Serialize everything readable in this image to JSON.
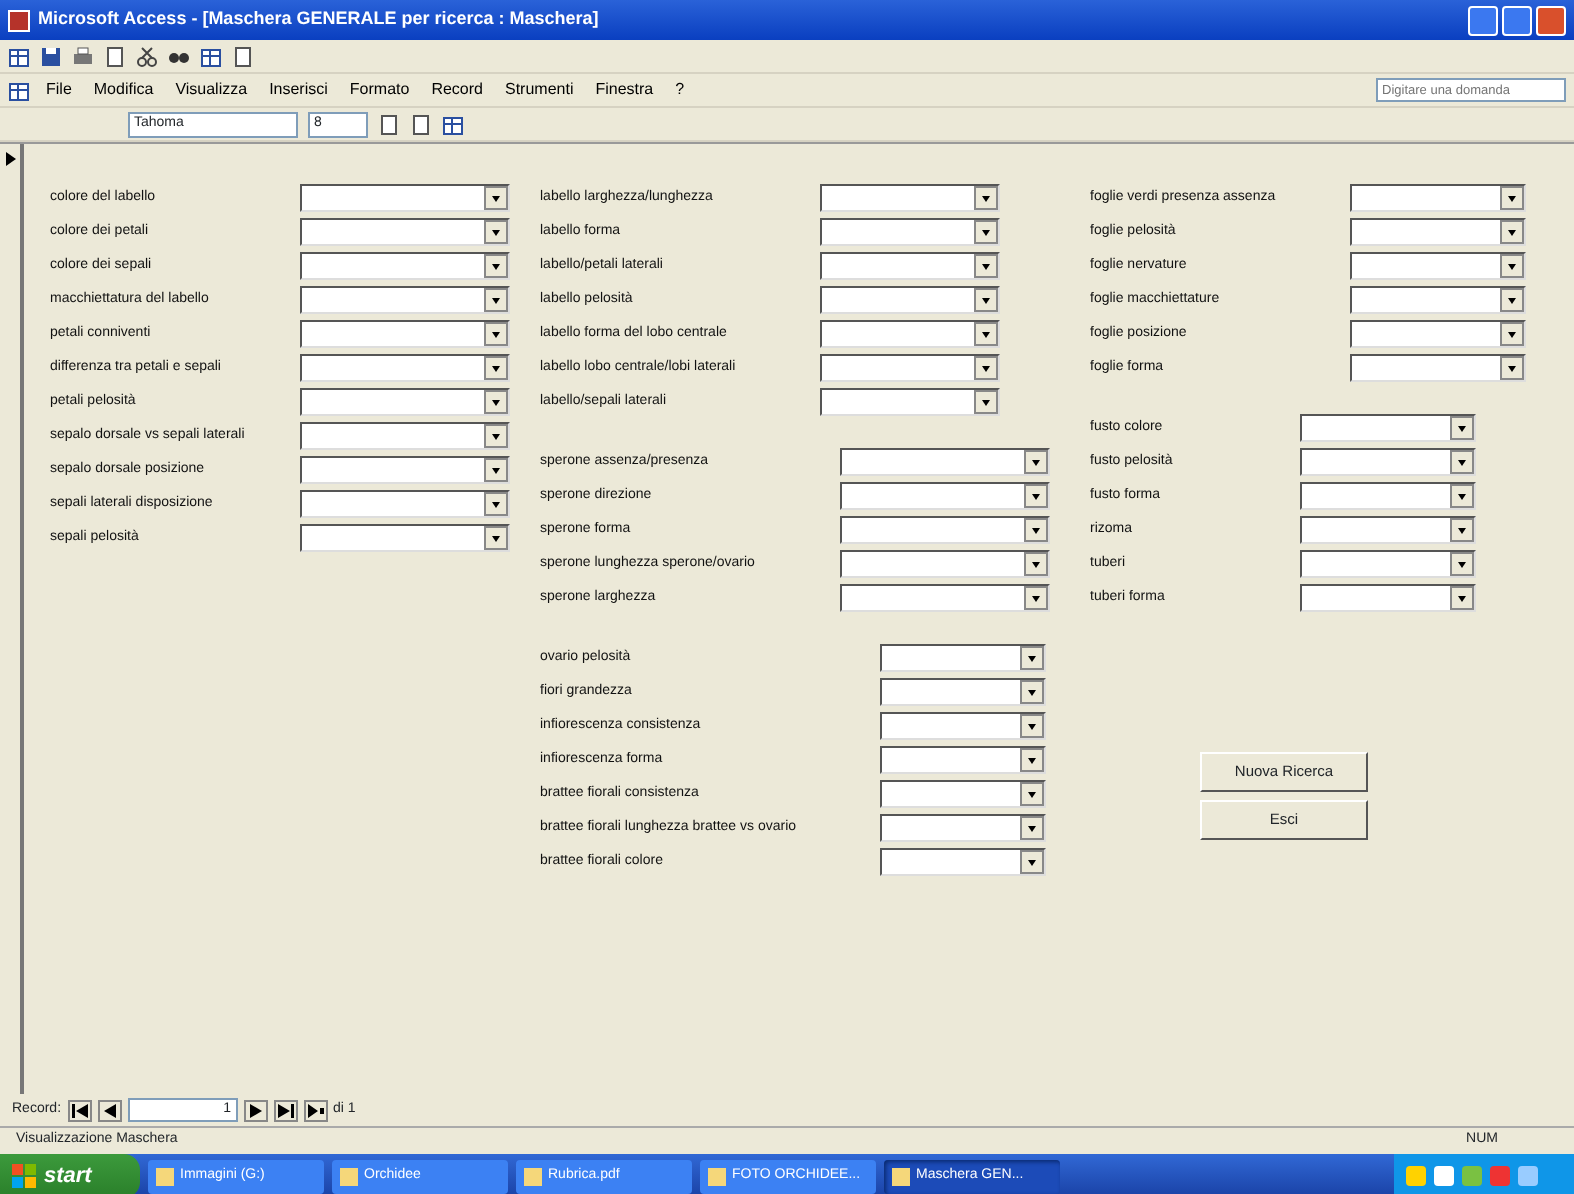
{
  "window": {
    "title": "Microsoft Access - [Maschera GENERALE per ricerca : Maschera]"
  },
  "menu": {
    "items": [
      "File",
      "Modifica",
      "Visualizza",
      "Inserisci",
      "Formato",
      "Record",
      "Strumenti",
      "Finestra",
      "?"
    ],
    "help_placeholder": "Digitare una domanda"
  },
  "format_bar": {
    "font": "Tahoma",
    "size": "8"
  },
  "form": {
    "columns": [
      {
        "groups": [
          {
            "fields": [
              {
                "label": "colore del labello"
              },
              {
                "label": "colore dei petali"
              },
              {
                "label": "colore dei sepali"
              },
              {
                "label": "macchiettatura del labello"
              },
              {
                "label": "petali conniventi"
              },
              {
                "label": "differenza tra petali e sepali"
              },
              {
                "label": "petali pelosità"
              },
              {
                "label": "sepalo dorsale vs sepali laterali"
              },
              {
                "label": "sepalo dorsale posizione"
              },
              {
                "label": "sepali laterali disposizione"
              },
              {
                "label": "sepali pelosità"
              }
            ]
          }
        ]
      },
      {
        "groups": [
          {
            "fields": [
              {
                "label": "labello larghezza/lunghezza"
              },
              {
                "label": "labello forma"
              },
              {
                "label": "labello/petali laterali"
              },
              {
                "label": "labello pelosità"
              },
              {
                "label": "labello forma del lobo centrale"
              },
              {
                "label": "labello lobo centrale/lobi laterali"
              },
              {
                "label": "labello/sepali laterali"
              }
            ]
          },
          {
            "fields": [
              {
                "label": "sperone assenza/presenza"
              },
              {
                "label": "sperone direzione"
              },
              {
                "label": "sperone forma"
              },
              {
                "label": "sperone lunghezza sperone/ovario"
              },
              {
                "label": "sperone larghezza"
              }
            ]
          },
          {
            "fields": [
              {
                "label": "ovario pelosità"
              },
              {
                "label": "fiori grandezza"
              },
              {
                "label": "infiorescenza consistenza"
              },
              {
                "label": "infiorescenza forma"
              },
              {
                "label": "brattee fiorali consistenza"
              },
              {
                "label": "brattee fiorali lunghezza brattee vs ovario"
              },
              {
                "label": "brattee fiorali colore"
              }
            ]
          }
        ]
      },
      {
        "groups": [
          {
            "fields": [
              {
                "label": "foglie verdi presenza assenza"
              },
              {
                "label": "foglie pelosità"
              },
              {
                "label": "foglie nervature"
              },
              {
                "label": "foglie macchiettature"
              },
              {
                "label": "foglie posizione"
              },
              {
                "label": "foglie forma"
              }
            ]
          },
          {
            "fields": [
              {
                "label": "fusto colore"
              },
              {
                "label": "fusto pelosità"
              },
              {
                "label": "fusto forma"
              },
              {
                "label": "rizoma"
              },
              {
                "label": "tuberi"
              },
              {
                "label": "tuberi forma"
              }
            ]
          }
        ]
      }
    ]
  },
  "buttons": [
    "Nuova Ricerca",
    "Esci"
  ],
  "record_nav": {
    "label": "Record:",
    "current": "1",
    "total": "di 1"
  },
  "status_bar": {
    "mode": "Visualizzazione Maschera",
    "indicator": "NUM"
  },
  "taskbar": {
    "start": "start",
    "tasks": [
      {
        "label": "Immagini (G:)",
        "selected": false
      },
      {
        "label": "Orchidee",
        "selected": false
      },
      {
        "label": "Rubrica.pdf",
        "selected": false
      },
      {
        "label": "FOTO ORCHIDEE...",
        "selected": false
      },
      {
        "label": "Maschera GEN...",
        "selected": true
      }
    ]
  }
}
